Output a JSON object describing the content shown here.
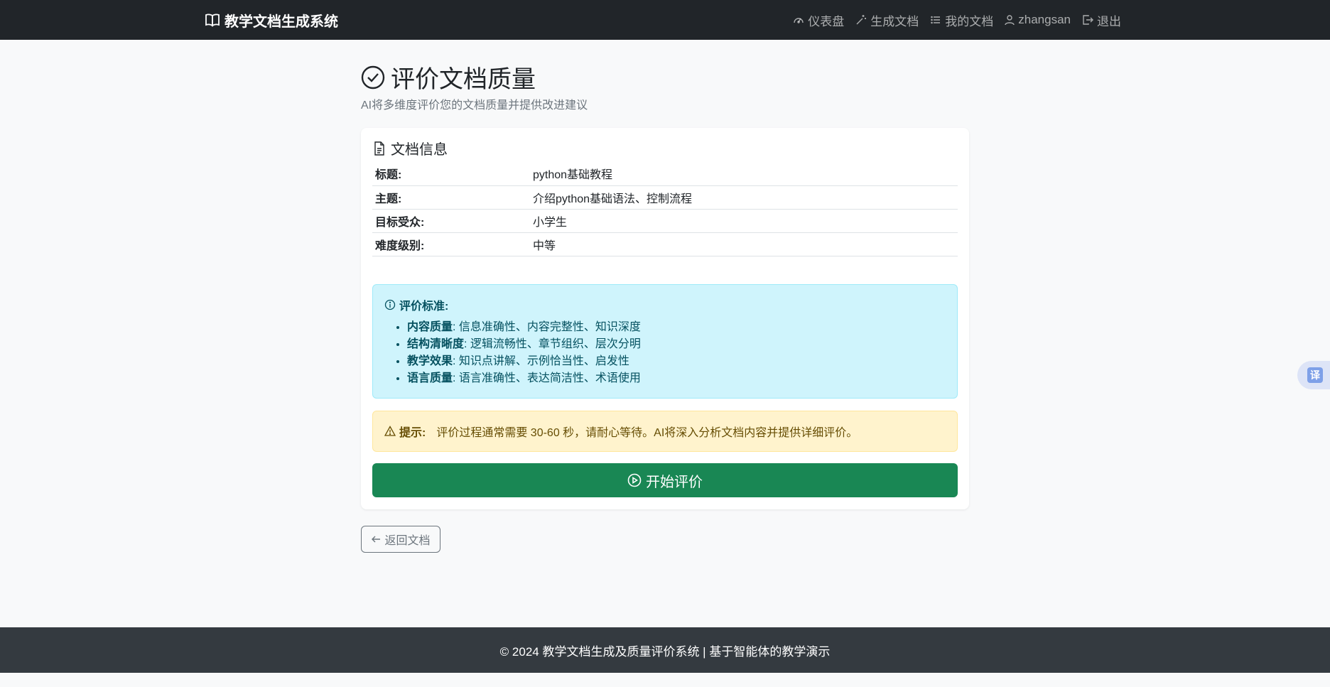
{
  "navbar": {
    "brand": "教学文档生成系统",
    "links": [
      {
        "label": "仪表盘",
        "icon": "dashboard-icon"
      },
      {
        "label": "生成文档",
        "icon": "magic-wand-icon"
      },
      {
        "label": "我的文档",
        "icon": "list-icon"
      },
      {
        "label": "zhangsan",
        "icon": "user-icon"
      },
      {
        "label": "退出",
        "icon": "logout-icon"
      }
    ]
  },
  "header": {
    "title": "评价文档质量",
    "subtitle": "AI将多维度评价您的文档质量并提供改进建议"
  },
  "doc_info": {
    "title": "文档信息",
    "rows": [
      {
        "key": "标题:",
        "value": "python基础教程"
      },
      {
        "key": "主题:",
        "value": "介绍python基础语法、控制流程"
      },
      {
        "key": "目标受众:",
        "value": "小学生"
      },
      {
        "key": "难度级别:",
        "value": "中等"
      }
    ]
  },
  "criteria": {
    "heading": "评价标准:",
    "items": [
      {
        "name": "内容质量",
        "desc": ": 信息准确性、内容完整性、知识深度"
      },
      {
        "name": "结构清晰度",
        "desc": ": 逻辑流畅性、章节组织、层次分明"
      },
      {
        "name": "教学效果",
        "desc": ": 知识点讲解、示例恰当性、启发性"
      },
      {
        "name": "语言质量",
        "desc": ": 语言准确性、表达简洁性、术语使用"
      }
    ]
  },
  "tip": {
    "label": "提示:",
    "text": "评价过程通常需要 30-60 秒，请耐心等待。AI将深入分析文档内容并提供详细评价。"
  },
  "start_button": "开始评价",
  "back_button": "返回文档",
  "footer": "© 2024 教学文档生成及质量评价系统 | 基于智能体的教学演示",
  "translate_label": "译",
  "colors": {
    "navbar": "#212529",
    "success": "#198754",
    "info_bg": "#cff4fc",
    "warning_bg": "#fff3cd",
    "footer": "#343a40"
  }
}
